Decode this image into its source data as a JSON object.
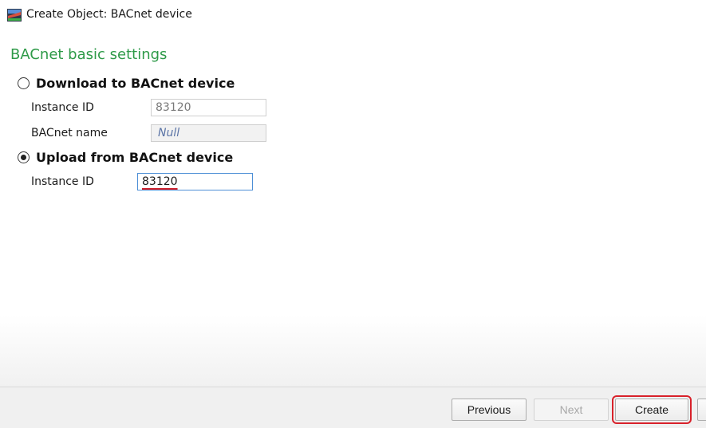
{
  "window": {
    "title": "Create Object: BACnet device",
    "icon": "bacnet-device-icon"
  },
  "section": {
    "title": "BACnet basic settings"
  },
  "download": {
    "label": "Download to BACnet device",
    "checked": false,
    "instance_id_label": "Instance ID",
    "instance_id_value": "83120",
    "bacnet_name_label": "BACnet name",
    "bacnet_name_value": "Null"
  },
  "upload": {
    "label": "Upload from BACnet device",
    "checked": true,
    "instance_id_label": "Instance ID",
    "instance_id_value": "83120"
  },
  "buttons": {
    "previous": "Previous",
    "next": "Next",
    "create": "Create"
  },
  "colors": {
    "section_title": "#2e9a48",
    "highlight": "#d8212a",
    "focus_border": "#4d8fd6"
  }
}
